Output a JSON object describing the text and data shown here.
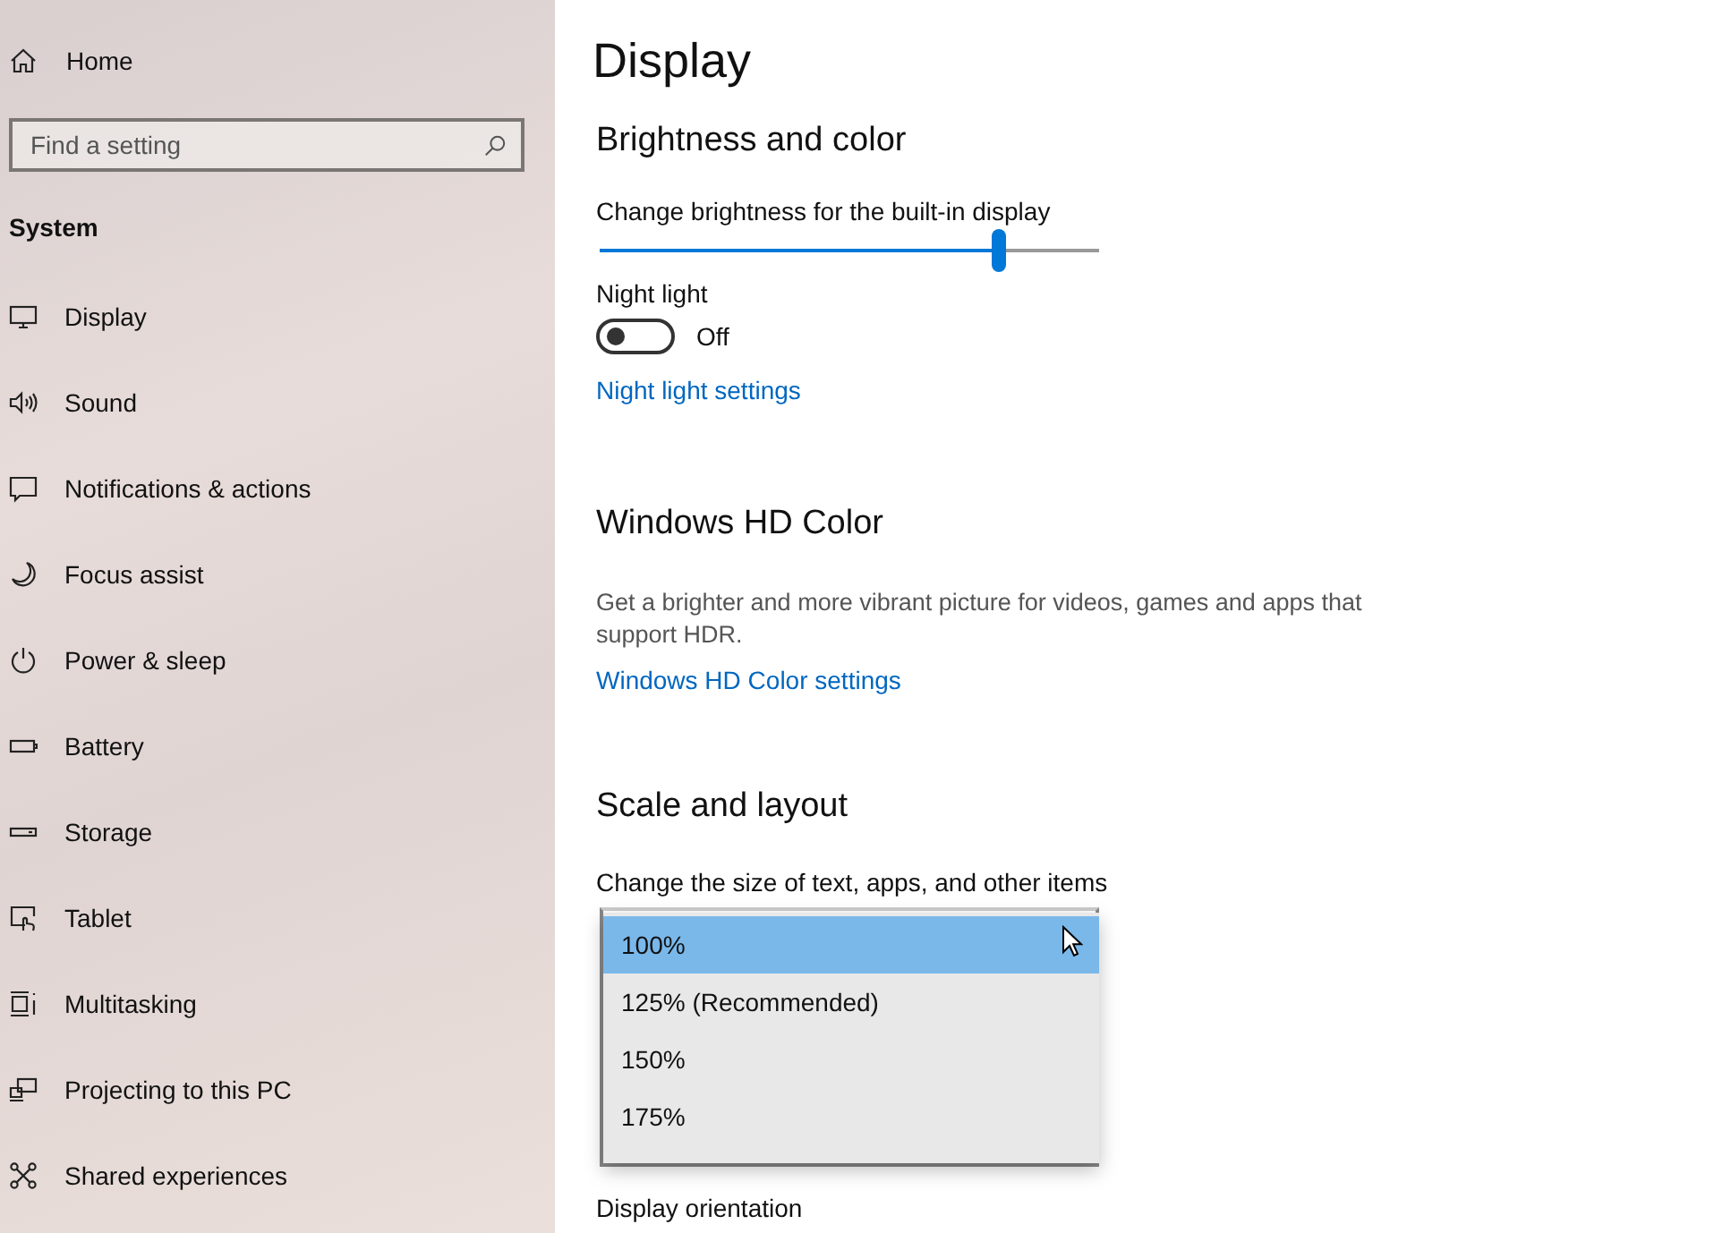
{
  "sidebar": {
    "home": "Home",
    "search": {
      "placeholder": "Find a setting"
    },
    "section": "System",
    "items": [
      {
        "label": "Display"
      },
      {
        "label": "Sound"
      },
      {
        "label": "Notifications & actions"
      },
      {
        "label": "Focus assist"
      },
      {
        "label": "Power & sleep"
      },
      {
        "label": "Battery"
      },
      {
        "label": "Storage"
      },
      {
        "label": "Tablet"
      },
      {
        "label": "Multitasking"
      },
      {
        "label": "Projecting to this PC"
      },
      {
        "label": "Shared experiences"
      }
    ]
  },
  "page": {
    "title": "Display",
    "brightness": {
      "heading": "Brightness and color",
      "label": "Change brightness for the built-in display",
      "level": 0.8
    },
    "night_light": {
      "label": "Night light",
      "on": false,
      "state": "Off",
      "link": "Night light settings"
    },
    "hd_color": {
      "heading": "Windows HD Color",
      "description": "Get a brighter and more vibrant picture for videos, games and apps that support HDR.",
      "link": "Windows HD Color settings"
    },
    "scale": {
      "heading": "Scale and layout",
      "label": "Change the size of text, apps, and other items",
      "options": [
        {
          "label": "100%",
          "selected": true
        },
        {
          "label": "125% (Recommended)",
          "selected": false
        },
        {
          "label": "150%",
          "selected": false
        },
        {
          "label": "175%",
          "selected": false
        }
      ]
    },
    "orientation_label": "Display orientation"
  }
}
